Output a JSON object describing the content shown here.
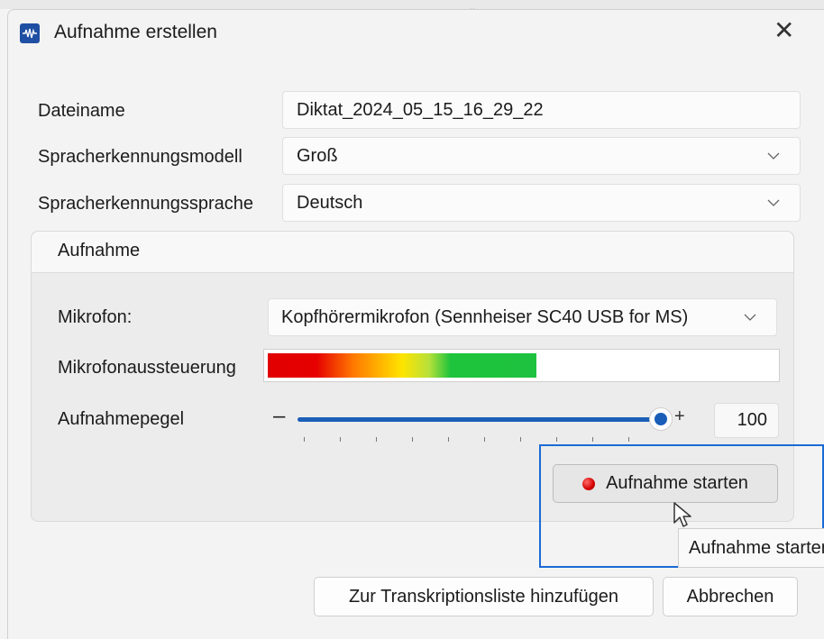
{
  "window": {
    "title": "Aufnahme erstellen",
    "close_glyph": "✕",
    "app_icon": "waveform-icon"
  },
  "top_fragment": "„",
  "form": {
    "filename_label": "Dateiname",
    "filename_value": "Diktat_2024_05_15_16_29_22",
    "model_label": "Spracherkennungsmodell",
    "model_value": "Groß",
    "language_label": "Spracherkennungssprache",
    "language_value": "Deutsch"
  },
  "recording_group": {
    "title": "Aufnahme",
    "microphone_label": "Mikrofon:",
    "microphone_value": "Kopfhörermikrofon (Sennheiser SC40 USB for MS)",
    "level_meter_label": "Mikrofonaussteuerung",
    "level_meter_value": 0.53,
    "gain_label": "Aufnahmepegel",
    "gain_minus": "–",
    "gain_plus": "+",
    "gain_value": "100",
    "gain_slider_fraction": 1.0,
    "start_button_label": "Aufnahme starten",
    "tooltip_text": "Aufnahme starten"
  },
  "footer": {
    "add_button_label": "Zur Transkriptionsliste hinzufügen",
    "cancel_button_label": "Abbrechen"
  },
  "colors": {
    "accent": "#1b5eb8",
    "focus": "#1a6bd6",
    "record": "#d40000"
  }
}
